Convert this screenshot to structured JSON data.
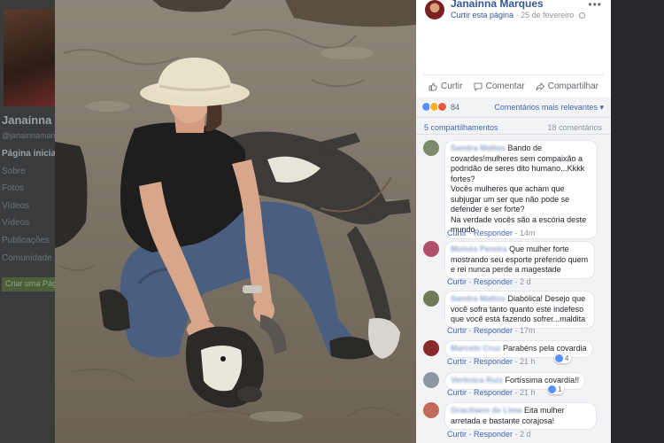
{
  "background_page": {
    "name": "Janaínna I",
    "handle": "@janainnamarq",
    "nav": [
      "Página inicial",
      "Sobre",
      "Fotos",
      "Vídeos",
      "Vídeos",
      "Publicações",
      "Comunidade"
    ],
    "button": "Criar uma Página"
  },
  "post": {
    "author": "Janaínna Marques",
    "follow_link": "Curtir esta página",
    "date": "25 de fevereiro",
    "more_icon": "more-horizontal-icon"
  },
  "actions": {
    "like": "Curtir",
    "comment": "Comentar",
    "share": "Compartilhar"
  },
  "stats": {
    "reaction_count": "84",
    "sort_label": "Comentários mais relevantes",
    "shares": "5 compartilhamentos",
    "comments": "18 comentários"
  },
  "comments": [
    {
      "name": "Sandra Mattos",
      "text": "Bando de covardes!mulheres sem compaixão a podridão de seres dito humano...Kkkk fortes?\nVocês mulheres que acham que subjugar um ser que não pode se defender é ser forte?\nNa verdade vocês são a escória deste mundo",
      "like": "Curtir",
      "reply": "Responder",
      "time": "14m",
      "avatar_color": "#7a8c6a"
    },
    {
      "name": "Moisés Pereira",
      "text": "Que mulher forte mostrando seu esporte preferido quem e rei nunca perde a magestade",
      "like": "Curtir",
      "reply": "Responder",
      "time": "2 d",
      "avatar_color": "#b0506a"
    },
    {
      "name": "Sandra Mattos",
      "text": "Diabólica! Desejo que você sofra tanto quanto este indefeso que você está fazendo sofrer...maldita",
      "like": "Curtir",
      "reply": "Responder",
      "time": "17m",
      "avatar_color": "#6d7d5a"
    },
    {
      "name": "Marcelo Cruz",
      "text": "Parabéns pela covardia",
      "like": "Curtir",
      "reply": "Responder",
      "time": "21 h",
      "avatar_color": "#8a2a2a",
      "likes": "4"
    },
    {
      "name": "Verônica Ruiz",
      "text": "Fortíssima covardia!!",
      "like": "Curtir",
      "reply": "Responder",
      "time": "21 h",
      "avatar_color": "#8d96a3",
      "likes": "1"
    },
    {
      "name": "Graciliano de Lima",
      "text": "Eita mulher arretada e bastante corajosa!",
      "like": "Curtir",
      "reply": "Responder",
      "time": "2 d",
      "avatar_color": "#c46a5a"
    }
  ],
  "colors": {
    "link": "#365899",
    "accent": "#4267b2",
    "muted": "#90949c",
    "panel_bg": "#f2f3f5"
  },
  "icons": {
    "like": "thumbs-up-icon",
    "comment": "speech-bubble-icon",
    "share": "share-arrow-icon",
    "globe": "globe-icon"
  }
}
